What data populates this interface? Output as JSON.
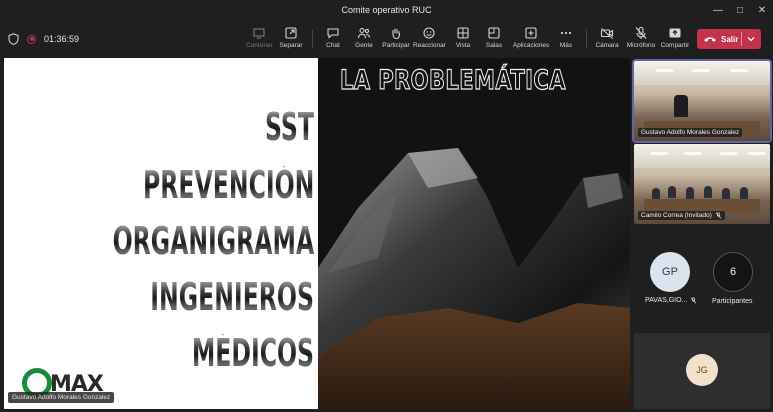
{
  "window": {
    "title": "Comite operativo RUC"
  },
  "toolbar": {
    "timer": "01:36:59",
    "tools": [
      {
        "label": "Contener",
        "icon": "contain-icon",
        "disabled": true
      },
      {
        "label": "Separar",
        "icon": "popout-icon",
        "disabled": false
      },
      {
        "label": "Chat",
        "icon": "chat-icon",
        "disabled": false
      },
      {
        "label": "Gente",
        "icon": "people-icon",
        "disabled": false
      },
      {
        "label": "Participar",
        "icon": "raise-hand-icon",
        "disabled": false
      },
      {
        "label": "Reaccionar",
        "icon": "react-icon",
        "disabled": false
      },
      {
        "label": "Vista",
        "icon": "view-icon",
        "disabled": false
      },
      {
        "label": "Salas",
        "icon": "rooms-icon",
        "disabled": false
      },
      {
        "label": "Aplicaciones",
        "icon": "apps-icon",
        "disabled": false
      },
      {
        "label": "Más",
        "icon": "more-icon",
        "disabled": false
      },
      {
        "label": "Cámara",
        "icon": "camera-off-icon",
        "disabled": false
      },
      {
        "label": "Micrófono",
        "icon": "mic-off-icon",
        "disabled": false
      },
      {
        "label": "Compartir",
        "icon": "share-icon",
        "disabled": false
      }
    ],
    "leave_label": "Salir"
  },
  "slide": {
    "title": "LA PROBLEMÁTICA",
    "words": [
      "SST",
      "PREVENCIÓN",
      "ORGANIGRAMA",
      "INGENIEROS",
      "MÉDICOS"
    ],
    "logo_text": "MAX",
    "presenter_name": "Gustavo Adolfo Morales Gonzalez"
  },
  "participants": {
    "tile1_name": "Gustavo Adolfo Morales Gonzalez",
    "tile2_name": "Camilo Correa (Invitado)",
    "gp_initials": "GP",
    "gp_name": "PAVAS,GIO...",
    "count": "6",
    "count_label": "Participantes",
    "jg_initials": "JG"
  },
  "colors": {
    "leave": "#c4314b",
    "accent": "#6264a7",
    "logo_green": "#1b8a3a"
  }
}
